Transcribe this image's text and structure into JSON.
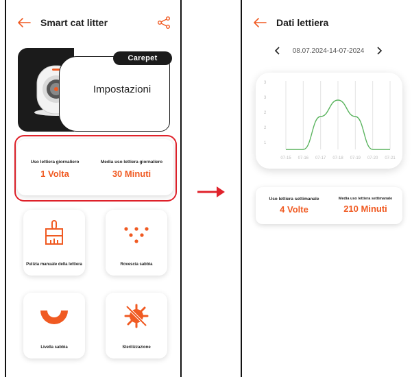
{
  "left_screen": {
    "header": {
      "title": "Smart cat litter"
    },
    "settings_card": {
      "brand": "Carepet",
      "label": "Impostazioni"
    },
    "usage": {
      "daily_label": "Uso lettiera giornaliero",
      "daily_value": "1 Volta",
      "avg_label": "Media uso lettiera giornaliero",
      "avg_value": "30 Minuti"
    },
    "tiles": [
      {
        "label": "Pulizia manuale della lettiera",
        "icon": "broom-icon"
      },
      {
        "label": "Rovescia sabbia",
        "icon": "dots-triangle-icon"
      },
      {
        "label": "Livella sabbia",
        "icon": "semicircle-icon"
      },
      {
        "label": "Sterilizzazione",
        "icon": "virus-crossed-icon"
      }
    ]
  },
  "right_screen": {
    "header": {
      "title": "Dati lettiera"
    },
    "date_range": "08.07.2024-14-07-2024",
    "weekly": {
      "usage_label": "Uso lettiera settimanale",
      "usage_value": "4 Volte",
      "avg_label": "Media uso lettiera settimanale",
      "avg_value": "210 Minuti"
    }
  },
  "colors": {
    "accent": "#f05a22",
    "highlight": "#e0222b",
    "line": "#5bb45f"
  },
  "chart_data": {
    "type": "line",
    "categories": [
      "07-15",
      "07-16",
      "07-17",
      "07-18",
      "07-19",
      "07-20",
      "07-21"
    ],
    "series": [
      {
        "values": [
          0,
          0,
          2,
          3,
          2,
          0,
          0
        ]
      }
    ],
    "y_ticks": [
      "1",
      "2",
      "2",
      "3",
      "3"
    ],
    "ylim": [
      0,
      4
    ],
    "grid": "vertical"
  }
}
